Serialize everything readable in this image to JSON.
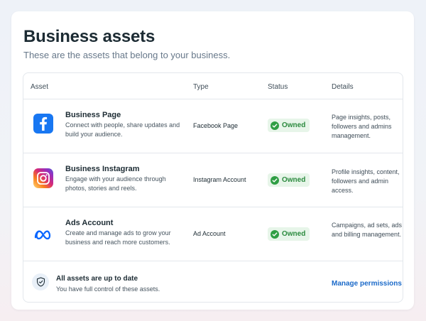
{
  "page": {
    "title": "Business assets",
    "subtitle": "These are the assets that belong to your business."
  },
  "table": {
    "headers": {
      "asset": "Asset",
      "type": "Type",
      "status": "Status",
      "details": "Details"
    },
    "rows": [
      {
        "icon": "facebook-icon",
        "name": "Business Page",
        "description": "Connect with people, share updates and build your audience.",
        "type": "Facebook Page",
        "status": "Owned",
        "details": "Page insights, posts, followers and admins management."
      },
      {
        "icon": "instagram-icon",
        "name": "Business Instagram",
        "description": "Engage with your audience through photos, stories and reels.",
        "type": "Instagram Account",
        "status": "Owned",
        "details": "Profile insights, content, followers and admin access."
      },
      {
        "icon": "meta-icon",
        "name": "Ads Account",
        "description": "Create and manage ads to grow your business and reach more customers.",
        "type": "Ad Account",
        "status": "Owned",
        "details": "Campaigns, ad sets, ads and billing management."
      }
    ]
  },
  "footer": {
    "icon": "shield-check-icon",
    "title": "All assets are up to date",
    "subtitle": "You have full control of these assets.",
    "link": "Manage permissions"
  },
  "colors": {
    "facebook_blue": "#1877f2",
    "meta_blue": "#0866ff",
    "owned_green": "#2f9e44",
    "link_blue": "#1b6ac9"
  }
}
